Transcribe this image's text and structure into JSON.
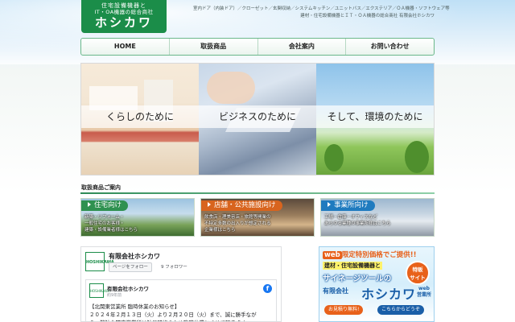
{
  "header": {
    "logo": {
      "line1": "住宅設備機器と",
      "line2": "IT・OA機器の総合商社",
      "name": "ホシカワ"
    },
    "tagline1": "室内ドア（内装ドア）／クローゼット／玄関収納／システムキッチン／ユニットバス／エクステリア／ＯＡ機器・ソフトウェア等",
    "tagline2": "建材・住宅設備機器とＩＴ・ＯＡ機器の総合商社 有限会社ホシカワ"
  },
  "nav": {
    "items": [
      "HOME",
      "取扱商品",
      "会社案内",
      "お問い合わせ"
    ]
  },
  "hero": {
    "panels": [
      "くらしのために",
      "ビジネスのために",
      "そして、環境のために"
    ]
  },
  "products": {
    "title": "取扱商品ご案内",
    "categories": [
      {
        "label": "住宅向け",
        "desc": "新築・リフォーム・\n一般住宅のお客様・\n建築・設備業者様はこちら"
      },
      {
        "label": "店舗・公共施設向け",
        "desc": "飲食店・理美容店・旅館等開業の\n不特定多数の出入りが想定される\n企業様はこちら"
      },
      {
        "label": "事業所向け",
        "desc": "工場・倉庫・オフィスなど\nあらゆる業種の事業所様はこちら"
      }
    ]
  },
  "facebook": {
    "page_name": "有限会社ホシカワ",
    "follow_label": "ページをフォロー",
    "follower_count": "9 フォロワー",
    "post": {
      "author": "有限会社ホシカワ",
      "time": "約9年前",
      "text": "【北関東営業所 臨時休業のお知らせ】\n２０２４年２月１３日（火）より２月２０日（火）まで、誠に勝手なが\nら、弊社北関東営業所は社員研修のため臨時休業とさせて頂きます。"
    }
  },
  "banner": {
    "top_prefix": "web",
    "top_text": "限定特別価格でご提供!!",
    "line1": "建材・住宅設備機器と",
    "line2": "サイネージツールの",
    "badge": "特販\nサイト",
    "line3": "有限会社",
    "line4": "ホシカワ",
    "line5": "web\n営業所",
    "btn1": "お見積り無料!",
    "btn2": "こちらからどうぞ"
  }
}
